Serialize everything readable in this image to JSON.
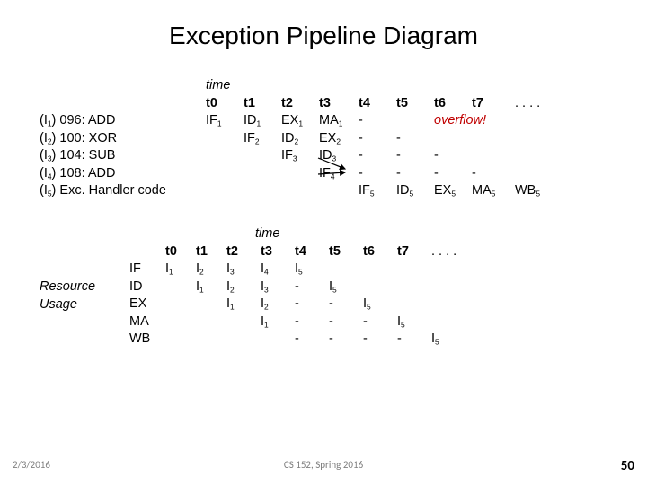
{
  "title": "Exception Pipeline Diagram",
  "footer": {
    "left": "2/3/2016",
    "center": "CS 152, Spring 2016",
    "right": "50"
  },
  "sec1": {
    "timehdr": "time",
    "cols": [
      "t0",
      "t1",
      "t2",
      "t3",
      "t4",
      "t5",
      "t6",
      "t7",
      ". . . ."
    ],
    "rows": [
      {
        "label": [
          "(I",
          "1",
          ") 096: ADD"
        ],
        "cells": [
          [
            "IF",
            "1"
          ],
          [
            "ID",
            "1"
          ],
          [
            "EX",
            "1"
          ],
          [
            "MA",
            "1"
          ],
          "-",
          "",
          [
            "overflow!",
            true
          ],
          "",
          ""
        ]
      },
      {
        "label": [
          "(I",
          "2",
          ") 100: XOR"
        ],
        "cells": [
          "",
          [
            "IF",
            "2"
          ],
          [
            "ID",
            "2"
          ],
          [
            "EX",
            "2"
          ],
          "-",
          "-",
          "",
          "",
          ""
        ]
      },
      {
        "label": [
          "(I",
          "3",
          ") 104: SUB"
        ],
        "cells": [
          "",
          "",
          [
            "IF",
            "3"
          ],
          [
            "ID",
            "3"
          ],
          "-",
          "-",
          "-",
          "",
          ""
        ]
      },
      {
        "label": [
          "(I",
          "4",
          ") 108: ADD"
        ],
        "cells": [
          "",
          "",
          "",
          [
            "IF",
            "4"
          ],
          "-",
          "-",
          "-",
          "-",
          ""
        ]
      },
      {
        "label": [
          "(I",
          "5",
          ") Exc. Handler code"
        ],
        "cells": [
          "",
          "",
          "",
          "",
          [
            "IF",
            "5"
          ],
          [
            "ID",
            "5"
          ],
          [
            "EX",
            "5"
          ],
          [
            "MA",
            "5"
          ],
          [
            "WB",
            "5"
          ]
        ]
      }
    ]
  },
  "sec2": {
    "timehdr": "time",
    "resuse": "Resource Usage",
    "stages": [
      "IF",
      "ID",
      "EX",
      "MA",
      "WB"
    ],
    "cols": [
      "t0",
      "t1",
      "t2",
      "t3",
      "t4",
      "t5",
      "t6",
      "t7",
      ". . . ."
    ],
    "rows": [
      [
        [
          "I",
          "1"
        ],
        [
          "I",
          "2"
        ],
        [
          "I",
          "3"
        ],
        [
          "I",
          "4"
        ],
        [
          "I",
          "5"
        ],
        "",
        "",
        "",
        ""
      ],
      [
        "",
        [
          "I",
          "1"
        ],
        [
          "I",
          "2"
        ],
        [
          "I",
          "3"
        ],
        "-",
        [
          "I",
          "5"
        ],
        "",
        "",
        ""
      ],
      [
        "",
        "",
        [
          "I",
          "1"
        ],
        [
          "I",
          "2"
        ],
        "-",
        "-",
        [
          "I",
          "5"
        ],
        "",
        ""
      ],
      [
        "",
        "",
        "",
        [
          "I",
          "1"
        ],
        "-",
        "-",
        "-",
        [
          "I",
          "5"
        ],
        ""
      ],
      [
        "",
        "",
        "",
        "",
        "-",
        "-",
        "-",
        "-",
        [
          "I",
          "5"
        ]
      ]
    ]
  },
  "chart_data": {
    "type": "table",
    "title": "Exception Pipeline Diagram",
    "pipeline_instructions": [
      {
        "id": "I1",
        "addr": "096",
        "op": "ADD",
        "stages": {
          "t0": "IF1",
          "t1": "ID1",
          "t2": "EX1",
          "t3": "MA1",
          "t4": "-",
          "t6": "overflow!"
        }
      },
      {
        "id": "I2",
        "addr": "100",
        "op": "XOR",
        "stages": {
          "t1": "IF2",
          "t2": "ID2",
          "t3": "EX2",
          "t4": "-",
          "t5": "-"
        }
      },
      {
        "id": "I3",
        "addr": "104",
        "op": "SUB",
        "stages": {
          "t2": "IF3",
          "t3": "ID3",
          "t4": "-",
          "t5": "-",
          "t6": "-"
        }
      },
      {
        "id": "I4",
        "addr": "108",
        "op": "ADD",
        "stages": {
          "t3": "IF4",
          "t4": "-",
          "t5": "-",
          "t6": "-",
          "t7": "-"
        }
      },
      {
        "id": "I5",
        "addr": "Exc. Handler code",
        "op": "",
        "stages": {
          "t4": "IF5",
          "t5": "ID5",
          "t6": "EX5",
          "t7": "MA5",
          "t8": "WB5"
        }
      }
    ],
    "resource_usage": {
      "stages": [
        "IF",
        "ID",
        "EX",
        "MA",
        "WB"
      ],
      "timeline": [
        "t0",
        "t1",
        "t2",
        "t3",
        "t4",
        "t5",
        "t6",
        "t7"
      ],
      "IF": [
        "I1",
        "I2",
        "I3",
        "I4",
        "I5",
        "",
        "",
        ""
      ],
      "ID": [
        "",
        "I1",
        "I2",
        "I3",
        "-",
        "I5",
        "",
        ""
      ],
      "EX": [
        "",
        "",
        "I1",
        "I2",
        "-",
        "-",
        "I5",
        ""
      ],
      "MA": [
        "",
        "",
        "",
        "I1",
        "-",
        "-",
        "-",
        "I5"
      ],
      "WB": [
        "",
        "",
        "",
        "",
        "-",
        "-",
        "-",
        "-",
        "I5"
      ]
    }
  }
}
